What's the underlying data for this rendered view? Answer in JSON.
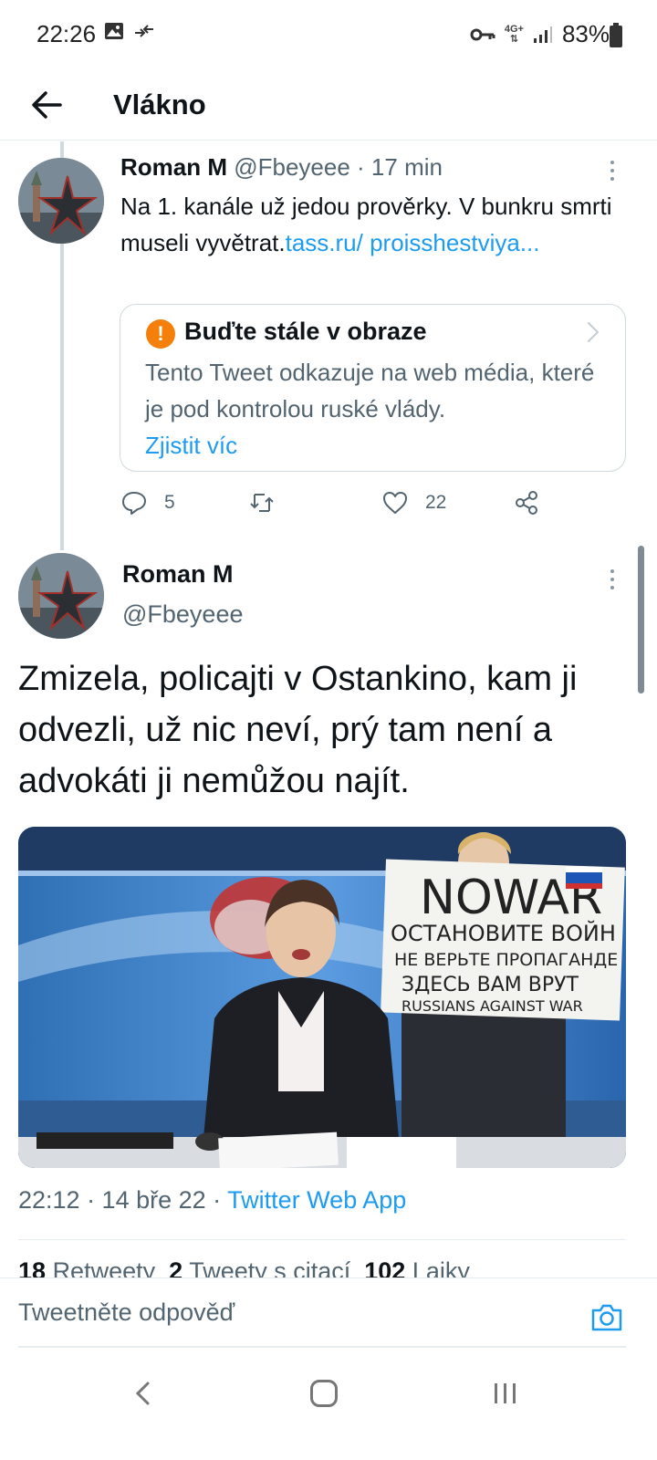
{
  "status_bar": {
    "time": "22:26",
    "network": "4G+",
    "battery": "83%"
  },
  "header": {
    "title": "Vlákno"
  },
  "tweet1": {
    "name": "Roman M",
    "handle": "@Fbeyeee",
    "time": "· 17 min",
    "text": "Na 1. kanále už jedou prověrky. V bunkru smrti museli vyvětrat.",
    "link_text": "tass.ru/ proisshestviya...",
    "notice": {
      "title": "Buďte stále v obraze",
      "body": "Tento Tweet odkazuje na web média, které je pod kontrolou ruské vlády.",
      "link": "Zjistit víc"
    },
    "replies": "5",
    "retweets": "",
    "likes": "22"
  },
  "tweet2": {
    "name": "Roman M",
    "handle": "@Fbeyeee",
    "text": "Zmizela, policajti v Ostankino, kam ji odvezli, už nic neví, prý tam není a advokáti ji nemůžou najít.",
    "media_sign": {
      "line1": "NOWAR",
      "line2": "ОСТАНОВИТЕ ВОЙН",
      "line3": "НЕ ВЕРЬТЕ ПРОПАГАНДЕ",
      "line4": "ЗДЕСЬ ВАМ ВРУТ",
      "line5": "RUSSIANS AGAINST WAR"
    },
    "timestamp": "22:12 · 14 bře 22 ·",
    "source": "Twitter Web App",
    "stats": {
      "retweets_count": "18",
      "retweets_label": "Retweety",
      "quotes_count": "2",
      "quotes_label": "Tweety s citací",
      "likes_count": "102",
      "likes_label": "Lajky"
    }
  },
  "reply": {
    "placeholder": "Tweetněte odpověď"
  }
}
